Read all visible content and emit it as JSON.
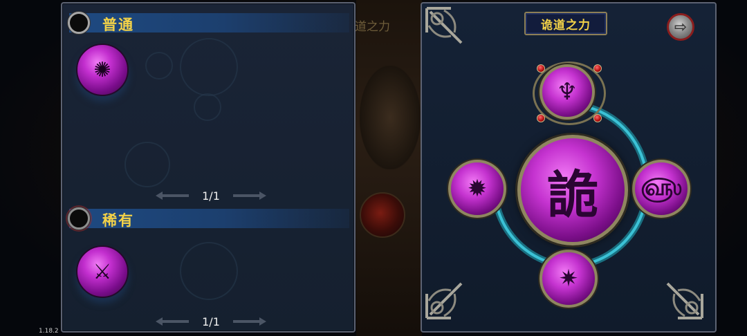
{
  "background": {
    "center_title": "诡道之力"
  },
  "left_panel": {
    "sections": [
      {
        "title": "普通",
        "ring_icon": "circle-ring-icon",
        "skill_icon": "dancer-glyph-icon",
        "page": "1/1"
      },
      {
        "title": "稀有",
        "ring_icon": "circle-ring-red-icon",
        "skill_icon": "blade-strike-glyph-icon",
        "page": "1/1"
      }
    ]
  },
  "right_panel": {
    "title": "诡道之力",
    "close_icon": "exit-door-icon",
    "center_orb": {
      "glyph": "詭"
    },
    "nodes": [
      {
        "position": "top",
        "icon": "goddess-glyph-icon"
      },
      {
        "position": "left",
        "icon": "burst-face-glyph-icon"
      },
      {
        "position": "right",
        "icon": "swirl-glyph-icon"
      },
      {
        "position": "bottom",
        "icon": "spiky-mask-glyph-icon"
      }
    ]
  },
  "colors": {
    "accent_gold": "#f3d248",
    "orb_magenta": "#c533d0",
    "link_cyan": "#2aa2b8",
    "header_blue": "#1e4a82"
  },
  "version": "1.18.2"
}
